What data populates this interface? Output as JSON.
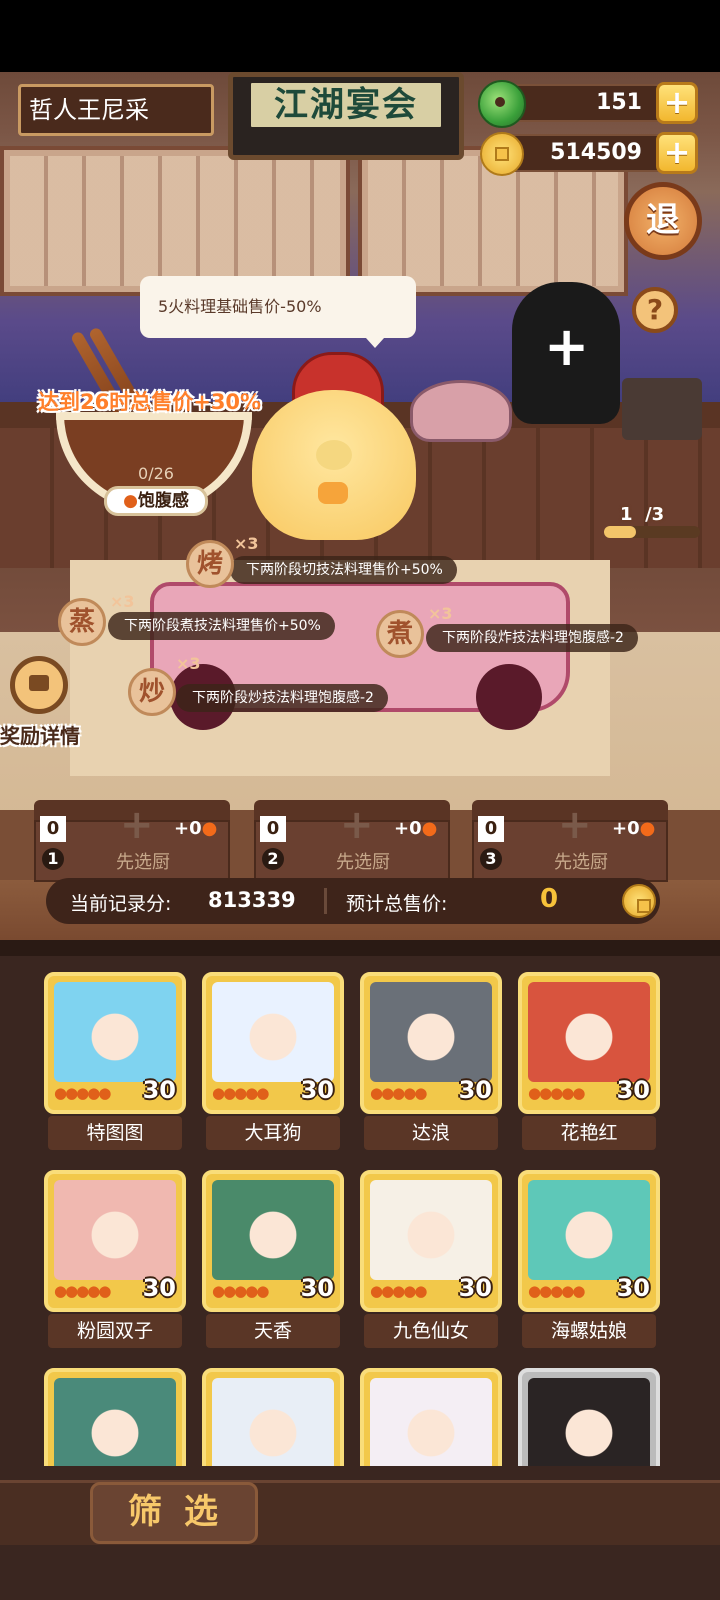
{
  "player": {
    "name": "哲人王尼采"
  },
  "sign": {
    "title": "江湖宴会"
  },
  "resources": {
    "jade": "151",
    "coins": "514509"
  },
  "buttons": {
    "exit": "退",
    "help": "?",
    "add_chef": "+"
  },
  "tooltip": {
    "text": "5火料理基础售价-50%"
  },
  "bowl": {
    "goal": "达到26时总售价+30%",
    "progress": "0/26",
    "satiety_label": "饱腹感"
  },
  "round": {
    "current": "1",
    "total": "/3",
    "fraction": 0.33
  },
  "buffs": [
    {
      "char": "烤",
      "mult": "×3",
      "text": "下两阶段切技法料理售价+50%"
    },
    {
      "char": "蒸",
      "mult": "×3",
      "text": "下两阶段煮技法料理售价+50%"
    },
    {
      "char": "煮",
      "mult": "×3",
      "text": "下两阶段炸技法料理饱腹感-2"
    },
    {
      "char": "炒",
      "mult": "×3",
      "text": "下两阶段炒技法料理饱腹感-2"
    }
  ],
  "reward": {
    "label": "奖励详情"
  },
  "slots": [
    {
      "num": "1",
      "score": "0",
      "fire": "+0",
      "label": "先选厨"
    },
    {
      "num": "2",
      "score": "0",
      "fire": "+0",
      "label": "先选厨"
    },
    {
      "num": "3",
      "score": "0",
      "fire": "+0",
      "label": "先选厨"
    }
  ],
  "scorebar": {
    "record_label": "当前记录分:",
    "record_value": "813339",
    "sale_label": "预计总售价:",
    "sale_value": "0"
  },
  "chefs": [
    {
      "name": "特图图",
      "level": "30",
      "color": "#7fd3f0"
    },
    {
      "name": "大耳狗",
      "level": "30",
      "color": "#e9f2ff"
    },
    {
      "name": "达浪",
      "level": "30",
      "color": "#6a7078"
    },
    {
      "name": "花艳红",
      "level": "30",
      "color": "#d8543e"
    },
    {
      "name": "粉圆双子",
      "level": "30",
      "color": "#f0b8b0"
    },
    {
      "name": "天香",
      "level": "30",
      "color": "#4a8a6a"
    },
    {
      "name": "九色仙女",
      "level": "30",
      "color": "#f6f0e6"
    },
    {
      "name": "海螺姑娘",
      "level": "30",
      "color": "#5ec8b8"
    },
    {
      "name": "",
      "level": "",
      "color": "#4a8a7a"
    },
    {
      "name": "",
      "level": "",
      "color": "#e8eef6"
    },
    {
      "name": "",
      "level": "",
      "color": "#f4eef4"
    },
    {
      "name": "",
      "level": "",
      "color": "#2a2424"
    }
  ],
  "filter": {
    "label": "筛选"
  }
}
